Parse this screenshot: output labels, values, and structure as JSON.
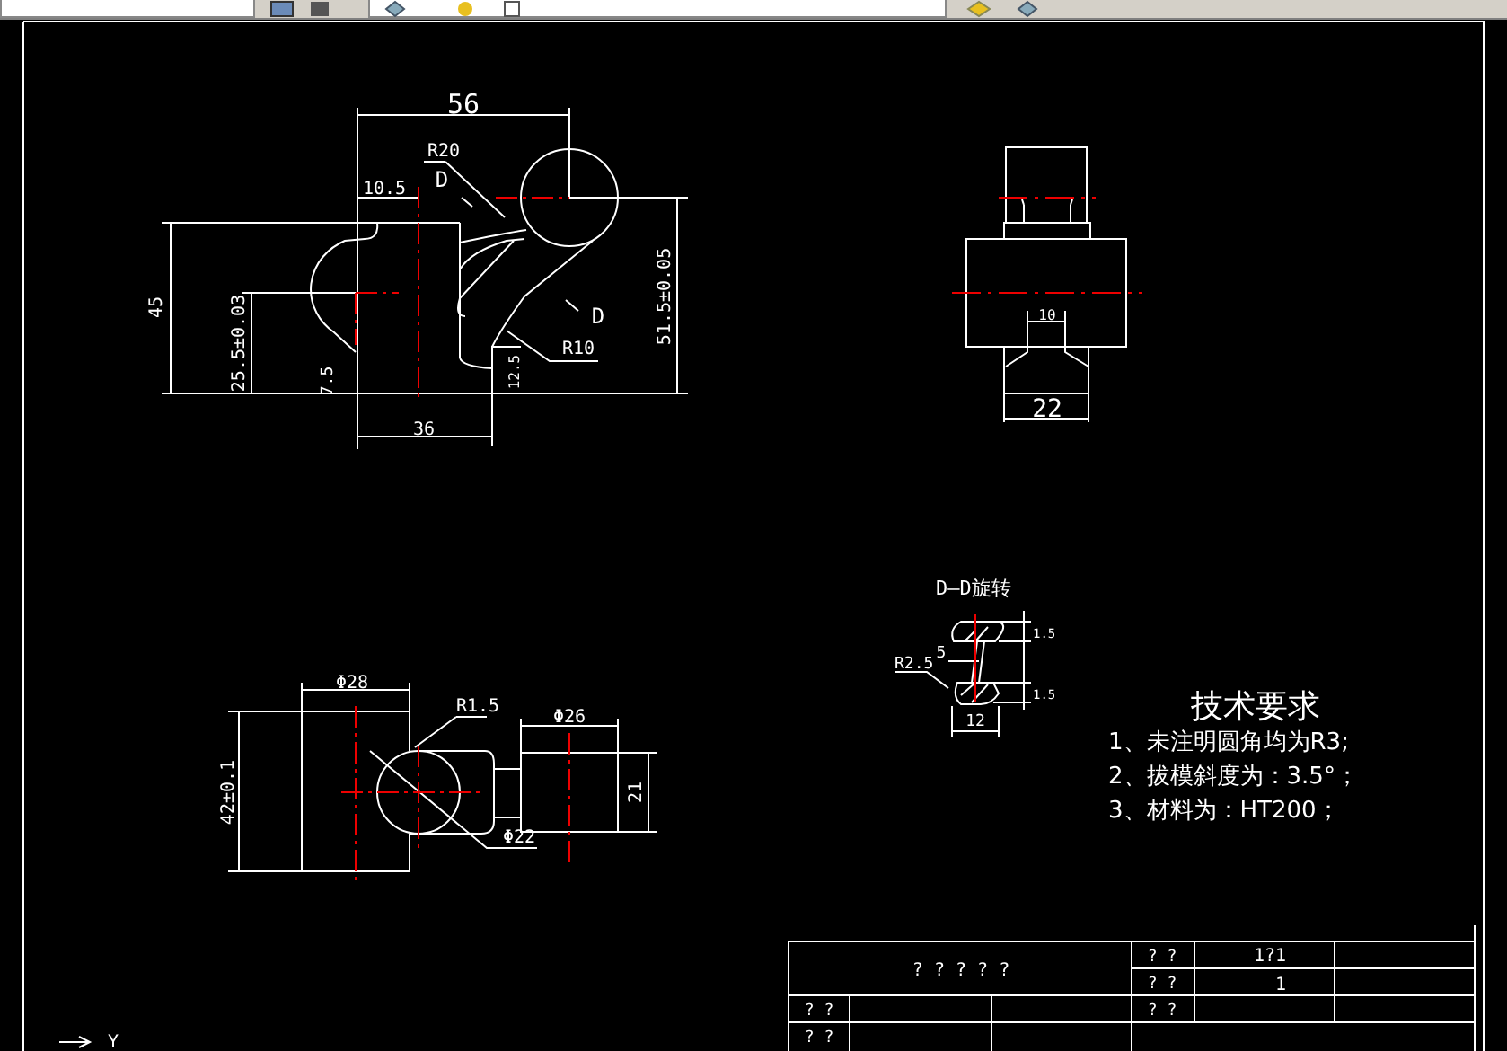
{
  "front_view": {
    "labels": [
      "56",
      "R20",
      "10.5",
      "D",
      "D",
      "45",
      "25.5±0.03",
      "7.5",
      "36",
      "12.5",
      "R10",
      "51.5±0.05"
    ]
  },
  "side_view": {
    "labels": [
      "10",
      "22"
    ]
  },
  "section_view": {
    "title": "D—D旋转",
    "labels": [
      "1.5",
      "5",
      "R2.5",
      "1.5",
      "12"
    ]
  },
  "top_view": {
    "labels": [
      "Φ28",
      "R1.5",
      "Φ26",
      "42±0.1",
      "21",
      "Φ22"
    ]
  },
  "technical_requirements": {
    "title": "技术要求",
    "items": [
      "1、未注明圆角均为R3;",
      "2、拔模斜度为：3.5°；",
      "3、材料为：HT200；"
    ]
  },
  "title_block": {
    "cells": [
      "? ? ? ? ?",
      "? ?",
      "1?1",
      "? ?",
      "1",
      "? ?",
      "? ?",
      "? ?"
    ]
  },
  "ucs": {
    "axis_label": "Y"
  }
}
